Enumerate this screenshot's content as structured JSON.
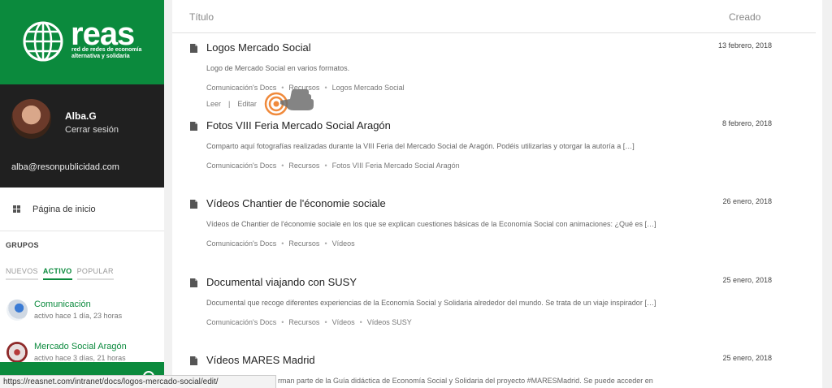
{
  "brand": {
    "name": "reas",
    "tagline_line1": "red de redes de economía",
    "tagline_line2": "alternativa y solidaria",
    "color": "#0b8a3d"
  },
  "user": {
    "name": "Alba.G",
    "logout_label": "Cerrar sesión",
    "email": "alba@resonpublicidad.com"
  },
  "nav": {
    "home_label": "Página de inicio"
  },
  "groups": {
    "title": "GRUPOS",
    "tabs": [
      "NUEVOS",
      "ACTIVO",
      "POPULAR"
    ],
    "active_tab": "ACTIVO",
    "items": [
      {
        "name": "Comunicación",
        "meta": "activo hace 1 día, 23 horas"
      },
      {
        "name": "Mercado Social Aragón",
        "meta": "activo hace 3 días, 21 horas"
      }
    ]
  },
  "table": {
    "col_title": "Título",
    "col_created": "Creado"
  },
  "docs": [
    {
      "title": "Logos Mercado Social",
      "date": "13 febrero, 2018",
      "desc": "Logo de Mercado Social en varios formatos.",
      "cats": [
        "Comunicación's Docs",
        "Recursos",
        "Logos Mercado Social"
      ],
      "actions": [
        "Leer",
        "Editar"
      ]
    },
    {
      "title": "Fotos VIII Feria Mercado Social Aragón",
      "date": "8 febrero, 2018",
      "desc": "Comparto aquí fotografías realizadas durante la VIII Feria del Mercado Social de Aragón. Podéis utilizarlas y otorgar la autoría a […]",
      "cats": [
        "Comunicación's Docs",
        "Recursos",
        "Fotos VIII Feria Mercado Social Aragón"
      ]
    },
    {
      "title": "Vídeos Chantier de l'économie sociale",
      "date": "26 enero, 2018",
      "desc": "Vídeos de Chantier de l'économie sociale en los que se explican cuestiones básicas de la Economía Social con animaciones: ¿Qué es […]",
      "cats": [
        "Comunicación's Docs",
        "Recursos",
        "Vídeos"
      ]
    },
    {
      "title": "Documental viajando con SUSY",
      "date": "25 enero, 2018",
      "desc": "Documental que recoge diferentes experiencias de la Economía Social y Solidaria alrededor del mundo. Se trata de un viaje inspirador […]",
      "cats": [
        "Comunicación's Docs",
        "Recursos",
        "Vídeos",
        "Vídeos SUSY"
      ]
    },
    {
      "title": "Vídeos MARES Madrid",
      "date": "25 enero, 2018",
      "desc": "rman parte de la Guía didáctica de Economía Social y Solidaria del proyecto #MARESMadrid. Se puede acceder en",
      "cats": []
    }
  ],
  "statusbar": {
    "url": "https://reasnet.com/intranet/docs/logos-mercado-social/edit/"
  }
}
